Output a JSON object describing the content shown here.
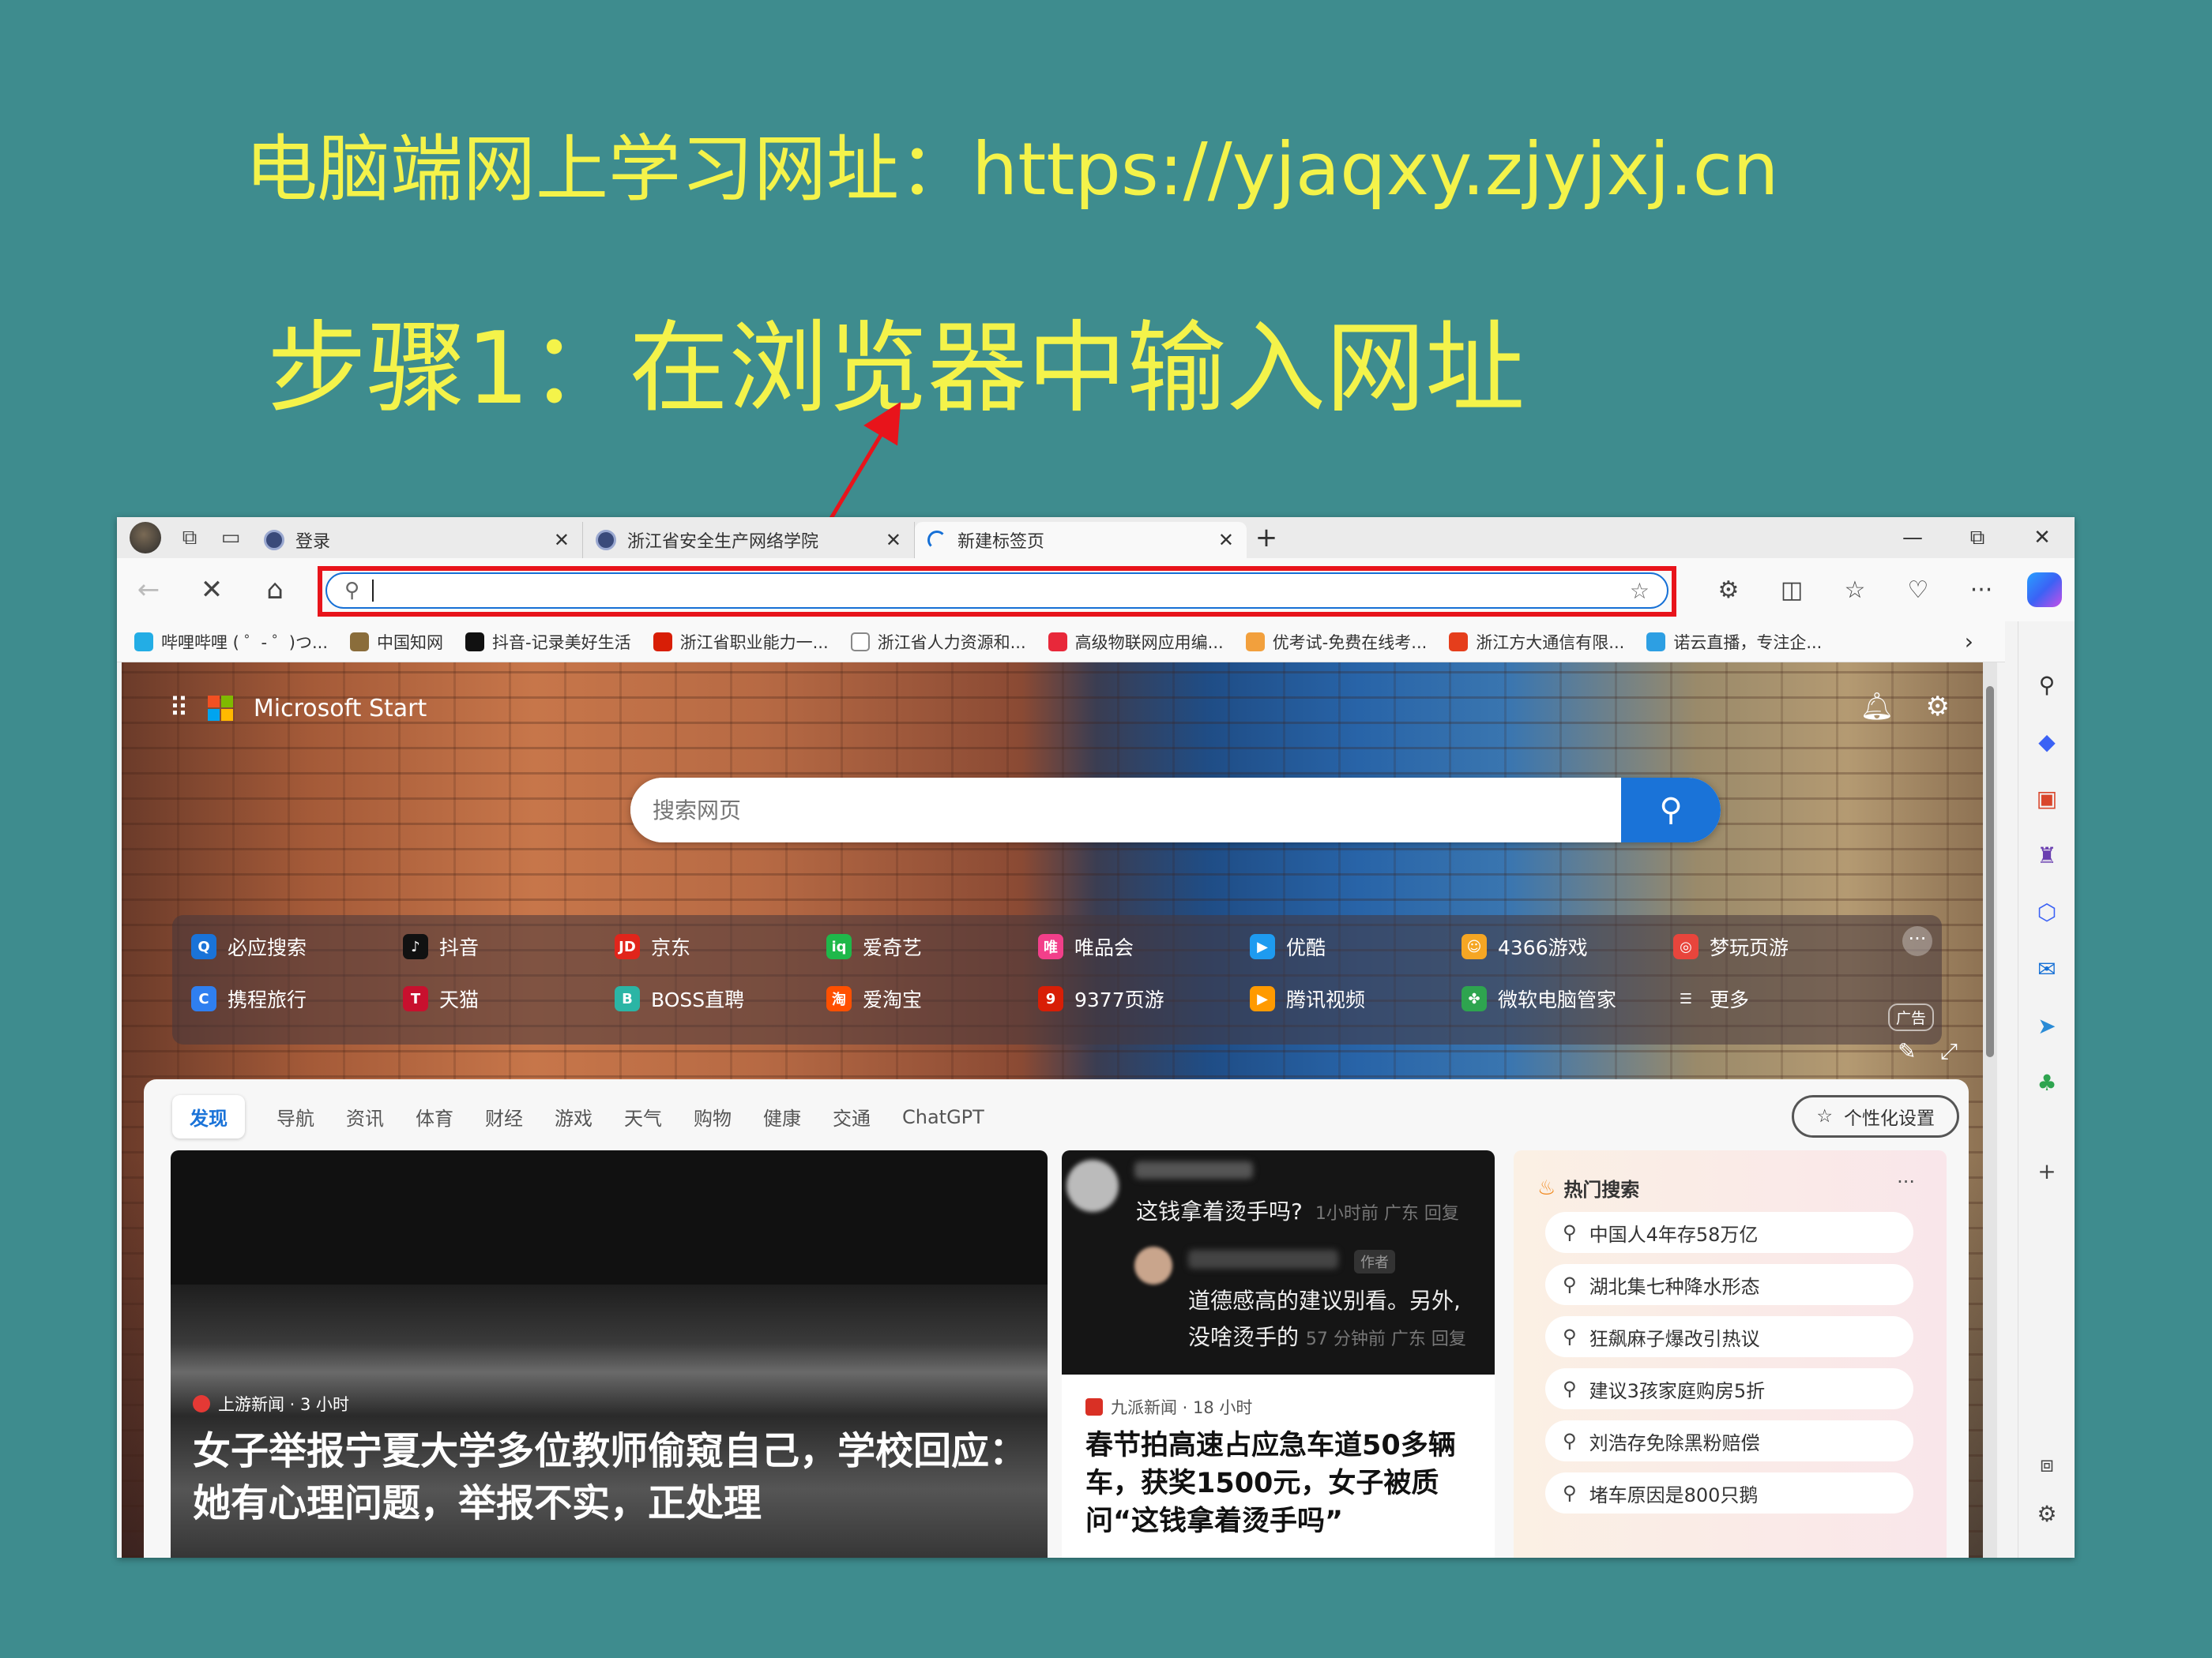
{
  "slide": {
    "title": "电脑端网上学习网址：https://yjaqxy.zjyjxj.cn",
    "step": "步骤1：在浏览器中输入网址"
  },
  "browser": {
    "tabs": [
      {
        "label": "登录",
        "icon": "globe-icon"
      },
      {
        "label": "浙江省安全生产网络学院",
        "icon": "globe-icon"
      },
      {
        "label": "新建标签页",
        "icon": "loading-spinner-icon",
        "active": true
      }
    ],
    "new_tab": "+",
    "window_controls": {
      "minimize": "—",
      "restore": "⧉",
      "close": "✕"
    },
    "address_bar": {
      "value": "",
      "placeholder": ""
    },
    "favorites": [
      {
        "label": "哔哩哔哩 ( ゜- ゜)つ...",
        "color": "#23ade5"
      },
      {
        "label": "中国知网",
        "color": "#8a6d3b"
      },
      {
        "label": "抖音-记录美好生活",
        "color": "#111111"
      },
      {
        "label": "浙江省职业能力一...",
        "color": "#d81e06"
      },
      {
        "label": "浙江省人力资源和...",
        "color": "#888888"
      },
      {
        "label": "高级物联网应用编...",
        "color": "#e8283a"
      },
      {
        "label": "优考试-免费在线考...",
        "color": "#f2a03d"
      },
      {
        "label": "浙江方大通信有限...",
        "color": "#e53e1c"
      },
      {
        "label": "诺云直播，专注企...",
        "color": "#2d9fe3"
      }
    ],
    "favorites_more": "›"
  },
  "newtab": {
    "brand": "Microsoft Start",
    "search_placeholder": "搜索网页",
    "quick_links": [
      {
        "label": "必应搜索",
        "color": "#1a73d8",
        "glyph": "Q"
      },
      {
        "label": "抖音",
        "color": "#111111",
        "glyph": "♪"
      },
      {
        "label": "京东",
        "color": "#e1251b",
        "glyph": "JD"
      },
      {
        "label": "爱奇艺",
        "color": "#1fb84a",
        "glyph": "iq"
      },
      {
        "label": "唯品会",
        "color": "#f23f8a",
        "glyph": "唯"
      },
      {
        "label": "优酷",
        "color": "#1e9bf0",
        "glyph": "▶"
      },
      {
        "label": "4366游戏",
        "color": "#f5a623",
        "glyph": "☺"
      },
      {
        "label": "梦玩页游",
        "color": "#e8453c",
        "glyph": "◎"
      },
      {
        "label": "携程旅行",
        "color": "#2f7ff0",
        "glyph": "C"
      },
      {
        "label": "天猫",
        "color": "#c8102e",
        "glyph": "T"
      },
      {
        "label": "BOSS直聘",
        "color": "#2bb5a5",
        "glyph": "B"
      },
      {
        "label": "爱淘宝",
        "color": "#ff5000",
        "glyph": "淘"
      },
      {
        "label": "9377页游",
        "color": "#d81e06",
        "glyph": "9"
      },
      {
        "label": "腾讯视频",
        "color": "#ff9a00",
        "glyph": "▶"
      },
      {
        "label": "微软电脑管家",
        "color": "#2ea44f",
        "glyph": "✤"
      },
      {
        "label": "更多",
        "color": "transparent",
        "glyph": "☰"
      }
    ],
    "ad_label": "广告",
    "feed_tabs": [
      "发现",
      "导航",
      "资讯",
      "体育",
      "财经",
      "游戏",
      "天气",
      "购物",
      "健康",
      "交通",
      "ChatGPT"
    ],
    "personalize": "个性化设置",
    "main_card": {
      "source": "上游新闻 · 3 小时",
      "headline": "女子举报宁夏大学多位教师偷窥自己，学校回应：她有心理问题，举报不实，正处理"
    },
    "mid_card": {
      "question": "这钱拿着烫手吗?",
      "question_meta": "1小时前 广东 回复",
      "author_tag": "作者",
      "reply_line1": "道德感高的建议别看。另外,",
      "reply_line2": "没啥烫手的",
      "reply_meta": "57 分钟前 广东 回复",
      "source": "九派新闻 · 18 小时",
      "title": "春节拍高速占应急车道50多辆车，获奖1500元，女子被质问“这钱拿着烫手吗”"
    },
    "hot_search": {
      "title": "热门搜索",
      "more": "···",
      "items": [
        "中国人4年存58万亿",
        "湖北集七种降水形态",
        "狂飙麻子爆改引热议",
        "建议3孩家庭购房5折",
        "刘浩存免除黑粉赔偿",
        "堵车原因是800只鹅"
      ]
    }
  }
}
